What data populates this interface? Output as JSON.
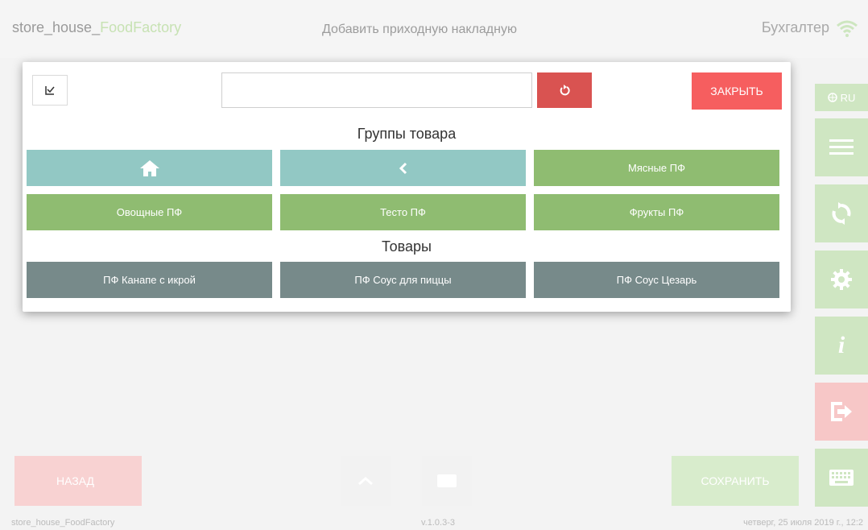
{
  "header": {
    "app_name_main": "store_house_",
    "app_name_accent": "FoodFactory",
    "page_title": "Добавить приходную накладную",
    "user": "Бухгалтер"
  },
  "sidebar": {
    "language": "RU",
    "items": [
      "globe-icon",
      "menu-icon",
      "sync-icon",
      "settings-icon",
      "info-icon",
      "logout-icon",
      "keyboard-icon"
    ]
  },
  "footer": {
    "back_label": "НАЗАД",
    "save_label": "СОХРАНИТЬ"
  },
  "status": {
    "app": "store_house_FoodFactory",
    "version": "v.1.0.3-3",
    "date": "четверг, 25 июля 2019 г., 12:2"
  },
  "modal": {
    "search_value": "",
    "close_label": "ЗАКРЫТЬ",
    "groups_title": "Группы товара",
    "groups": [
      "Мясные ПФ",
      "Овощные ПФ",
      "Тесто ПФ",
      "Фрукты ПФ"
    ],
    "products_title": "Товары",
    "products": [
      "ПФ Канапе с икрой",
      "ПФ Соус для пиццы",
      "ПФ Соус Цезарь"
    ]
  },
  "colors": {
    "teal": "#92c8c4",
    "green": "#8fbc71",
    "gray": "#778a8a",
    "red": "#f65e5f"
  }
}
